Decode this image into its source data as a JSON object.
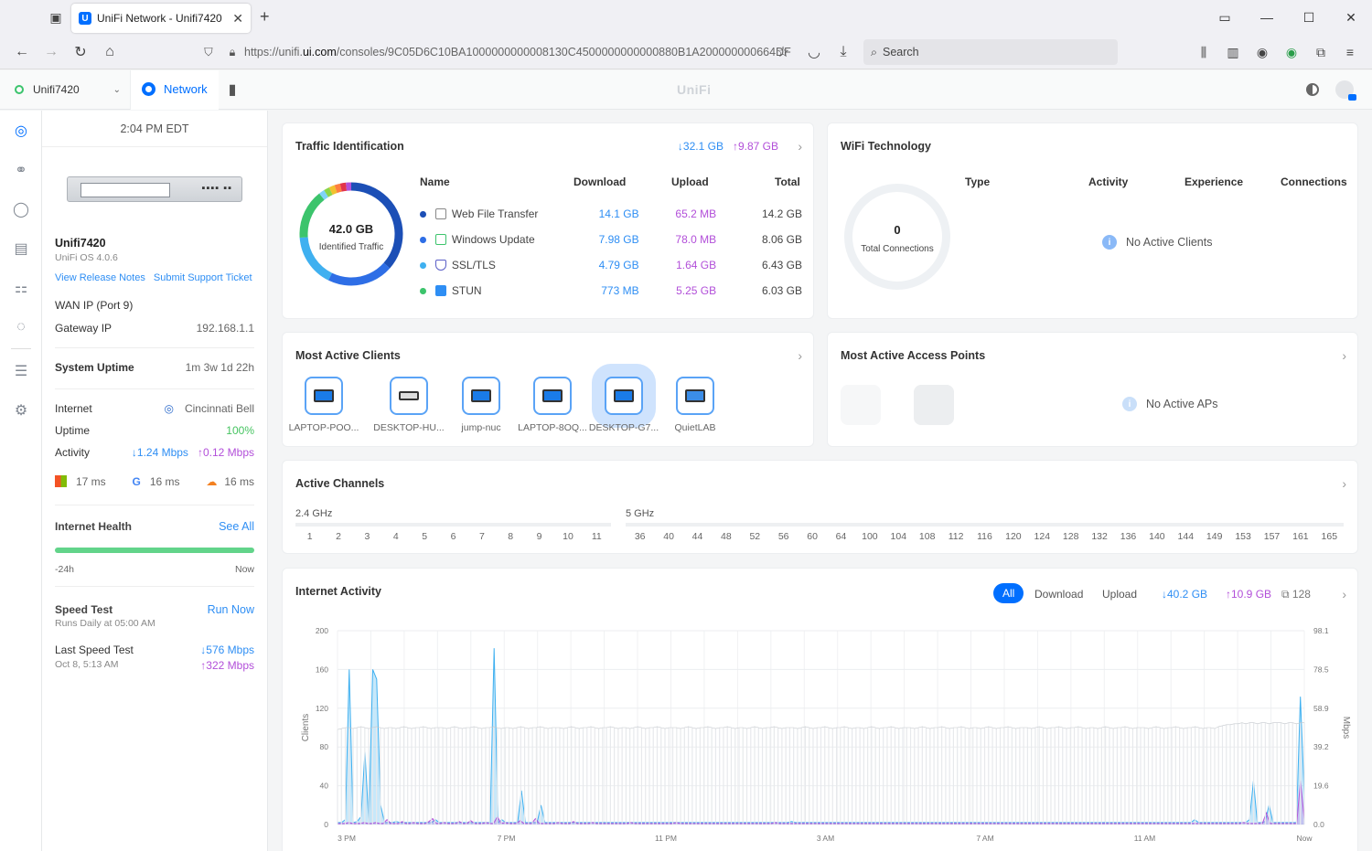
{
  "browser": {
    "tab_title": "UniFi Network - Unifi7420",
    "url_prefix": "https://unifi.",
    "url_domain": "ui.com",
    "url_path": "/consoles/9C05D6C10BA1000000000008130C4500000000000880B1A200000000664DF",
    "search_placeholder": "Search",
    "favicon_text": "U"
  },
  "appbar": {
    "site": "Unifi7420",
    "app": "Network",
    "logo": "UniFi"
  },
  "sidebar": {
    "time": "2:04 PM EDT",
    "device_name": "Unifi7420",
    "os": "UniFi OS 4.0.6",
    "release_notes": "View Release Notes",
    "support": "Submit Support Ticket",
    "wan": "WAN IP (Port 9)",
    "gateway_label": "Gateway IP",
    "gateway_value": "192.168.1.1",
    "uptime_label": "System Uptime",
    "uptime_value": "1m 3w 1d 22h",
    "internet_label": "Internet",
    "isp": "Cincinnati Bell",
    "uptime2_label": "Uptime",
    "uptime2_value": "100%",
    "activity_label": "Activity",
    "activity_down": "↓1.24 Mbps",
    "activity_up": "↑0.12 Mbps",
    "lat1": "17 ms",
    "lat2": "16 ms",
    "lat3": "16 ms",
    "health_label": "Internet Health",
    "see_all": "See All",
    "h_start": "-24h",
    "h_end": "Now",
    "speed_label": "Speed Test",
    "speed_sub": "Runs Daily at 05:00 AM",
    "run_now": "Run Now",
    "last_label": "Last Speed Test",
    "last_date": "Oct 8, 5:13 AM",
    "last_down": "↓576 Mbps",
    "last_up": "↑322 Mbps"
  },
  "traffic": {
    "title": "Traffic Identification",
    "total_down": "↓32.1 GB",
    "total_up": "↑9.87 GB",
    "donut_value": "42.0 GB",
    "donut_label": "Identified Traffic",
    "headers": {
      "name": "Name",
      "download": "Download",
      "upload": "Upload",
      "total": "Total"
    },
    "rows": [
      {
        "name": "Web File Transfer",
        "download": "14.1 GB",
        "upload": "65.2 MB",
        "total": "14.2 GB",
        "color": "#1c4fb6"
      },
      {
        "name": "Windows Update",
        "download": "7.98 GB",
        "upload": "78.0 MB",
        "total": "8.06 GB",
        "color": "#2e6ee6"
      },
      {
        "name": "SSL/TLS",
        "download": "4.79 GB",
        "upload": "1.64 GB",
        "total": "6.43 GB",
        "color": "#3fb0f0"
      },
      {
        "name": "STUN",
        "download": "773 MB",
        "upload": "5.25 GB",
        "total": "6.03 GB",
        "color": "#3cc46c"
      }
    ]
  },
  "wifi": {
    "title": "WiFi Technology",
    "headers": {
      "type": "Type",
      "activity": "Activity",
      "experience": "Experience",
      "connections": "Connections"
    },
    "connections_value": "0",
    "connections_label": "Total Connections",
    "empty": "No Active Clients"
  },
  "clients": {
    "title": "Most Active Clients",
    "items": [
      "LAPTOP-POO...",
      "DESKTOP-HU...",
      "jump-nuc",
      "LAPTOP-8OQ...",
      "DESKTOP-G7...",
      "QuietLAB"
    ]
  },
  "aps": {
    "title": "Most Active Access Points",
    "empty": "No Active APs"
  },
  "channels": {
    "title": "Active Channels",
    "band24": "2.4 GHz",
    "band5": "5 GHz",
    "ch24": [
      "1",
      "2",
      "3",
      "4",
      "5",
      "6",
      "7",
      "8",
      "9",
      "10",
      "11"
    ],
    "ch5": [
      "36",
      "40",
      "44",
      "48",
      "52",
      "56",
      "60",
      "64",
      "100",
      "104",
      "108",
      "112",
      "116",
      "120",
      "124",
      "128",
      "132",
      "136",
      "140",
      "144",
      "149",
      "153",
      "157",
      "161",
      "165"
    ]
  },
  "activity": {
    "title": "Internet Activity",
    "filters": [
      "All",
      "Download",
      "Upload"
    ],
    "down": "↓40.2 GB",
    "up": "↑10.9 GB",
    "count": "128"
  },
  "chart_data": {
    "type": "area",
    "ylabel": "Clients",
    "y2label": "Mbps",
    "yticks": [
      "200",
      "160",
      "120",
      "80",
      "40",
      "0"
    ],
    "y2ticks": [
      "98.1",
      "78.5",
      "58.9",
      "39.2",
      "19.6",
      "0.0"
    ],
    "ylim": [
      0,
      200
    ],
    "y2lim": [
      0,
      98.1
    ],
    "xticks": [
      "3 PM",
      "7 PM",
      "11 PM",
      "3 AM",
      "7 AM",
      "11 AM",
      "Now"
    ],
    "series": [
      {
        "values": [
          2,
          2,
          5,
          160,
          2,
          3,
          8,
          75,
          2,
          160,
          150,
          20,
          2,
          2,
          2,
          3,
          2,
          2,
          2,
          2,
          2,
          2,
          2,
          2,
          2,
          5,
          2,
          2,
          2,
          2,
          2,
          2,
          2,
          2,
          2,
          2,
          2,
          2,
          2,
          2,
          182,
          2,
          5,
          2,
          2,
          2,
          2,
          35,
          2,
          2,
          2,
          2,
          20,
          2,
          2,
          2,
          2,
          2,
          2,
          2,
          2,
          2,
          2,
          2,
          2,
          2,
          2,
          2,
          2,
          2,
          2,
          2,
          2,
          2,
          2,
          2,
          2,
          2,
          2,
          2,
          2,
          2,
          2,
          2,
          2,
          2,
          2,
          2,
          2,
          2,
          2,
          2,
          2,
          2,
          2,
          2,
          2,
          2,
          2,
          2,
          2,
          2,
          2,
          2,
          2,
          2,
          2,
          2,
          2,
          2,
          2,
          2,
          2,
          2,
          2,
          2,
          3,
          2,
          2,
          2,
          2,
          2,
          2,
          2,
          2,
          2,
          2,
          2,
          2,
          2,
          2,
          2,
          2,
          2,
          2,
          2,
          2,
          2,
          2,
          2,
          2,
          2,
          2,
          2,
          2,
          2,
          2,
          2,
          2,
          2,
          2,
          2,
          2,
          2,
          2,
          2,
          2,
          2,
          2,
          2,
          2,
          2,
          2,
          2,
          2,
          2,
          2,
          2,
          2,
          2,
          2,
          2,
          2,
          2,
          2,
          2,
          2,
          2,
          2,
          2,
          2,
          2,
          2,
          2,
          2,
          2,
          2,
          2,
          2,
          2,
          2,
          2,
          2,
          2,
          2,
          2,
          2,
          2,
          2,
          2,
          2,
          2,
          2,
          2,
          2,
          2,
          2,
          2,
          2,
          2,
          2,
          2,
          2,
          2,
          2,
          2,
          2,
          2,
          2,
          5,
          2,
          2,
          2,
          2,
          2,
          2,
          2,
          2,
          2,
          2,
          2,
          2,
          2,
          5,
          45,
          2,
          2,
          3,
          20,
          2,
          2,
          2,
          2,
          2,
          2,
          2,
          132,
          30
        ]
      },
      {
        "values": [
          1,
          1,
          1,
          2,
          1,
          1,
          1,
          2,
          1,
          1,
          2,
          1,
          1,
          5,
          1,
          1,
          1,
          3,
          1,
          1,
          2,
          1,
          1,
          1,
          3,
          6,
          1,
          1,
          2,
          1,
          1,
          1,
          3,
          1,
          1,
          4,
          1,
          1,
          1,
          2,
          1,
          1,
          8,
          1,
          2,
          1,
          1,
          1,
          4,
          1,
          1,
          1,
          6,
          1,
          1,
          1,
          1,
          1,
          2,
          1,
          1,
          1,
          3,
          1,
          1,
          1,
          1,
          2,
          1,
          1,
          1,
          1,
          1,
          1,
          1,
          1,
          1,
          2,
          1,
          1,
          1,
          1,
          1,
          1,
          1,
          1,
          1,
          1,
          1,
          2,
          1,
          1,
          1,
          1,
          1,
          1,
          1,
          1,
          1,
          1,
          1,
          1,
          1,
          1,
          1,
          1,
          1,
          1,
          1,
          1,
          1,
          1,
          1,
          1,
          1,
          2,
          1,
          1,
          1,
          1,
          1,
          1,
          1,
          1,
          1,
          1,
          1,
          1,
          1,
          1,
          1,
          1,
          1,
          1,
          1,
          1,
          1,
          1,
          1,
          1,
          1,
          1,
          1,
          1,
          1,
          1,
          1,
          1,
          1,
          1,
          1,
          1,
          1,
          1,
          1,
          1,
          1,
          1,
          1,
          1,
          1,
          1,
          1,
          1,
          1,
          1,
          1,
          1,
          1,
          1,
          1,
          1,
          1,
          1,
          1,
          1,
          1,
          1,
          1,
          1,
          1,
          1,
          1,
          1,
          1,
          1,
          1,
          1,
          1,
          1,
          1,
          1,
          1,
          1,
          1,
          1,
          1,
          1,
          1,
          1,
          1,
          1,
          1,
          1,
          1,
          1,
          1,
          1,
          1,
          1,
          1,
          1,
          1,
          1,
          1,
          1,
          1,
          1,
          1,
          1,
          1,
          1,
          1,
          1,
          1,
          1,
          1,
          1,
          1,
          1,
          1,
          1,
          1,
          1,
          1,
          1,
          1,
          1,
          2,
          1,
          1,
          1,
          1,
          1,
          12,
          1,
          1,
          1,
          1,
          1,
          1,
          1,
          1,
          45,
          5
        ]
      },
      {
        "values": [
          98,
          99,
          100,
          100,
          99,
          100,
          101,
          100,
          99,
          100,
          101,
          100,
          99,
          100,
          100,
          99,
          100,
          101,
          100,
          99,
          100,
          100,
          101,
          100,
          99,
          100,
          100,
          100,
          99,
          100,
          101,
          100,
          99,
          100,
          100,
          101,
          100,
          99,
          100,
          100,
          101,
          100,
          99,
          100,
          100,
          99,
          100,
          101,
          100,
          99,
          100,
          100,
          101,
          100,
          99,
          100,
          100,
          100,
          99,
          100,
          101,
          100,
          99,
          100,
          100,
          101,
          100,
          99,
          100,
          100,
          101,
          100,
          99,
          100,
          100,
          99,
          100,
          101,
          100,
          99,
          100,
          100,
          101,
          100,
          99,
          100,
          100,
          100,
          99,
          100,
          101,
          100,
          99,
          100,
          100,
          101,
          100,
          99,
          100,
          100,
          101,
          100,
          99,
          100,
          100,
          99,
          100,
          101,
          100,
          99,
          100,
          100,
          101,
          100,
          99,
          100,
          100,
          100,
          99,
          100,
          101,
          100,
          99,
          100,
          100,
          101,
          100,
          99,
          100,
          100,
          101,
          100,
          99,
          100,
          100,
          99,
          100,
          101,
          100,
          99,
          100,
          100,
          101,
          100,
          99,
          100,
          100,
          100,
          99,
          100,
          101,
          100,
          99,
          100,
          100,
          101,
          100,
          99,
          100,
          100,
          101,
          100,
          99,
          100,
          100,
          99,
          100,
          101,
          100,
          99,
          100,
          100,
          101,
          100,
          99,
          100,
          100,
          100,
          99,
          100,
          101,
          100,
          99,
          100,
          100,
          101,
          100,
          99,
          100,
          100,
          101,
          100,
          99,
          100,
          100,
          99,
          100,
          101,
          100,
          99,
          100,
          100,
          101,
          100,
          99,
          100,
          100,
          100,
          99,
          100,
          101,
          100,
          99,
          100,
          100,
          101,
          100,
          99,
          100,
          100,
          101,
          100,
          99,
          100,
          100,
          99,
          101,
          102,
          103,
          103,
          104,
          104,
          105,
          104,
          105,
          105,
          104,
          105,
          105,
          104,
          105,
          105,
          105,
          104,
          105,
          105,
          104,
          105,
          105
        ]
      }
    ]
  },
  "colors": {
    "accent": "#006fff",
    "download": "#2e8ef4",
    "upload": "#b24fd9",
    "good": "#46c461"
  }
}
